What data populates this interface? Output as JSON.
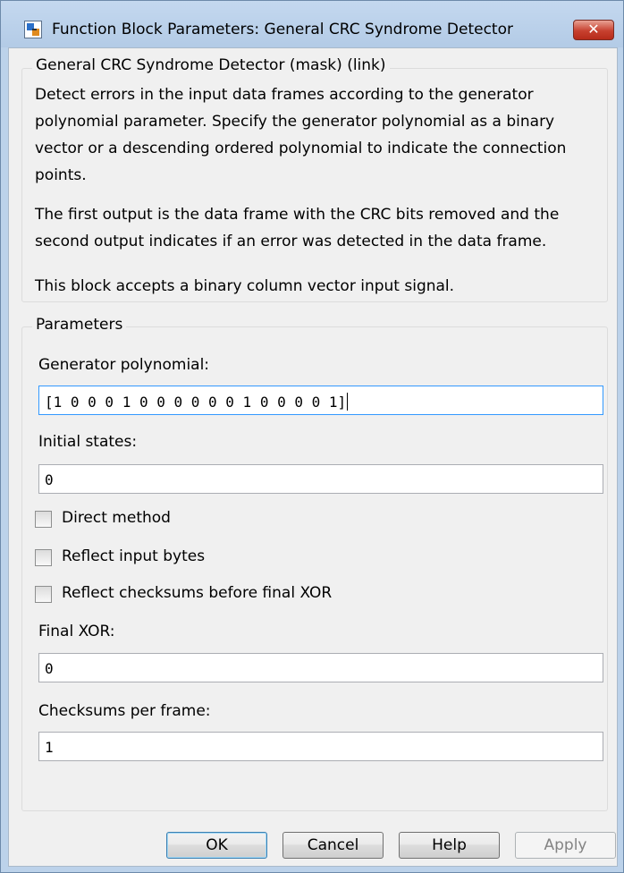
{
  "window": {
    "title": "Function Block Parameters: General CRC Syndrome Detector",
    "close_label": "✕"
  },
  "description_group": {
    "legend": "General CRC Syndrome Detector (mask) (link)",
    "paragraph1_lines": [
      "Detect errors in the input data frames according to the generator",
      "polynomial parameter. Specify the generator polynomial as a binary",
      "vector or a descending ordered polynomial to indicate the connection",
      "points."
    ],
    "paragraph2_lines": [
      "The first output is the data frame with the CRC bits removed and the",
      "second output indicates if an error was detected in the data frame."
    ],
    "paragraph3": "This block accepts a binary column vector input signal."
  },
  "parameters": {
    "legend": "Parameters",
    "generator_polynomial": {
      "label": "Generator polynomial:",
      "value": "[1 0 0 0 1 0 0 0 0 0 0 1 0 0 0 0 1]"
    },
    "initial_states": {
      "label": "Initial states:",
      "value": "0"
    },
    "direct_method": {
      "label": "Direct method",
      "checked": false
    },
    "reflect_input_bytes": {
      "label": "Reflect input bytes",
      "checked": false
    },
    "reflect_checksums": {
      "label": "Reflect checksums before final XOR",
      "checked": false
    },
    "final_xor": {
      "label": "Final XOR:",
      "value": "0"
    },
    "checksums_per_frame": {
      "label": "Checksums per frame:",
      "value": "1"
    }
  },
  "buttons": {
    "ok": "OK",
    "cancel": "Cancel",
    "help": "Help",
    "apply": "Apply"
  },
  "colors": {
    "title_bar": "#bcd2ea",
    "close_button": "#c7402f",
    "focus_border": "#3399ff",
    "dialog_background": "#f0f0f0"
  }
}
